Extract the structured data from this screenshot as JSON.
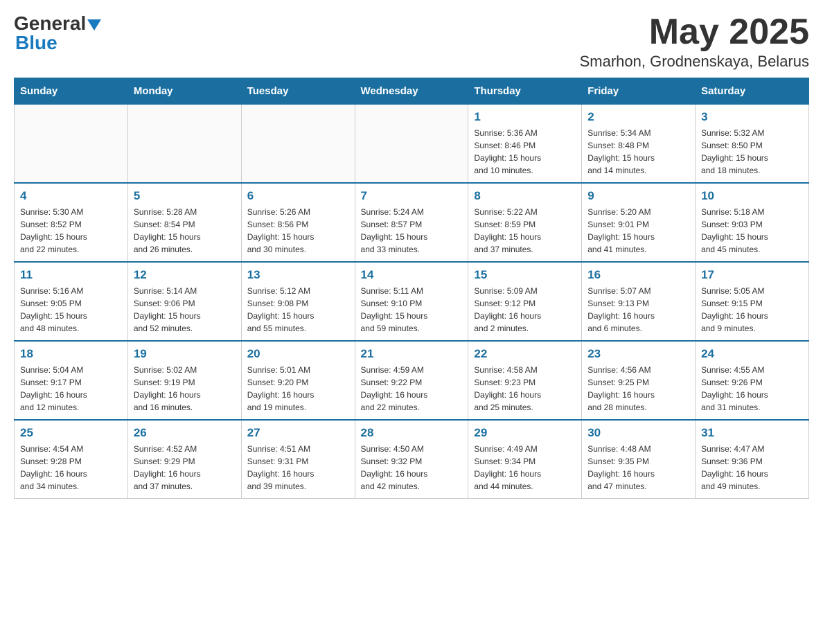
{
  "header": {
    "logo_general": "General",
    "logo_blue": "Blue",
    "month_year": "May 2025",
    "location": "Smarhon, Grodnenskaya, Belarus"
  },
  "weekdays": [
    "Sunday",
    "Monday",
    "Tuesday",
    "Wednesday",
    "Thursday",
    "Friday",
    "Saturday"
  ],
  "weeks": [
    [
      {
        "day": "",
        "info": ""
      },
      {
        "day": "",
        "info": ""
      },
      {
        "day": "",
        "info": ""
      },
      {
        "day": "",
        "info": ""
      },
      {
        "day": "1",
        "info": "Sunrise: 5:36 AM\nSunset: 8:46 PM\nDaylight: 15 hours\nand 10 minutes."
      },
      {
        "day": "2",
        "info": "Sunrise: 5:34 AM\nSunset: 8:48 PM\nDaylight: 15 hours\nand 14 minutes."
      },
      {
        "day": "3",
        "info": "Sunrise: 5:32 AM\nSunset: 8:50 PM\nDaylight: 15 hours\nand 18 minutes."
      }
    ],
    [
      {
        "day": "4",
        "info": "Sunrise: 5:30 AM\nSunset: 8:52 PM\nDaylight: 15 hours\nand 22 minutes."
      },
      {
        "day": "5",
        "info": "Sunrise: 5:28 AM\nSunset: 8:54 PM\nDaylight: 15 hours\nand 26 minutes."
      },
      {
        "day": "6",
        "info": "Sunrise: 5:26 AM\nSunset: 8:56 PM\nDaylight: 15 hours\nand 30 minutes."
      },
      {
        "day": "7",
        "info": "Sunrise: 5:24 AM\nSunset: 8:57 PM\nDaylight: 15 hours\nand 33 minutes."
      },
      {
        "day": "8",
        "info": "Sunrise: 5:22 AM\nSunset: 8:59 PM\nDaylight: 15 hours\nand 37 minutes."
      },
      {
        "day": "9",
        "info": "Sunrise: 5:20 AM\nSunset: 9:01 PM\nDaylight: 15 hours\nand 41 minutes."
      },
      {
        "day": "10",
        "info": "Sunrise: 5:18 AM\nSunset: 9:03 PM\nDaylight: 15 hours\nand 45 minutes."
      }
    ],
    [
      {
        "day": "11",
        "info": "Sunrise: 5:16 AM\nSunset: 9:05 PM\nDaylight: 15 hours\nand 48 minutes."
      },
      {
        "day": "12",
        "info": "Sunrise: 5:14 AM\nSunset: 9:06 PM\nDaylight: 15 hours\nand 52 minutes."
      },
      {
        "day": "13",
        "info": "Sunrise: 5:12 AM\nSunset: 9:08 PM\nDaylight: 15 hours\nand 55 minutes."
      },
      {
        "day": "14",
        "info": "Sunrise: 5:11 AM\nSunset: 9:10 PM\nDaylight: 15 hours\nand 59 minutes."
      },
      {
        "day": "15",
        "info": "Sunrise: 5:09 AM\nSunset: 9:12 PM\nDaylight: 16 hours\nand 2 minutes."
      },
      {
        "day": "16",
        "info": "Sunrise: 5:07 AM\nSunset: 9:13 PM\nDaylight: 16 hours\nand 6 minutes."
      },
      {
        "day": "17",
        "info": "Sunrise: 5:05 AM\nSunset: 9:15 PM\nDaylight: 16 hours\nand 9 minutes."
      }
    ],
    [
      {
        "day": "18",
        "info": "Sunrise: 5:04 AM\nSunset: 9:17 PM\nDaylight: 16 hours\nand 12 minutes."
      },
      {
        "day": "19",
        "info": "Sunrise: 5:02 AM\nSunset: 9:19 PM\nDaylight: 16 hours\nand 16 minutes."
      },
      {
        "day": "20",
        "info": "Sunrise: 5:01 AM\nSunset: 9:20 PM\nDaylight: 16 hours\nand 19 minutes."
      },
      {
        "day": "21",
        "info": "Sunrise: 4:59 AM\nSunset: 9:22 PM\nDaylight: 16 hours\nand 22 minutes."
      },
      {
        "day": "22",
        "info": "Sunrise: 4:58 AM\nSunset: 9:23 PM\nDaylight: 16 hours\nand 25 minutes."
      },
      {
        "day": "23",
        "info": "Sunrise: 4:56 AM\nSunset: 9:25 PM\nDaylight: 16 hours\nand 28 minutes."
      },
      {
        "day": "24",
        "info": "Sunrise: 4:55 AM\nSunset: 9:26 PM\nDaylight: 16 hours\nand 31 minutes."
      }
    ],
    [
      {
        "day": "25",
        "info": "Sunrise: 4:54 AM\nSunset: 9:28 PM\nDaylight: 16 hours\nand 34 minutes."
      },
      {
        "day": "26",
        "info": "Sunrise: 4:52 AM\nSunset: 9:29 PM\nDaylight: 16 hours\nand 37 minutes."
      },
      {
        "day": "27",
        "info": "Sunrise: 4:51 AM\nSunset: 9:31 PM\nDaylight: 16 hours\nand 39 minutes."
      },
      {
        "day": "28",
        "info": "Sunrise: 4:50 AM\nSunset: 9:32 PM\nDaylight: 16 hours\nand 42 minutes."
      },
      {
        "day": "29",
        "info": "Sunrise: 4:49 AM\nSunset: 9:34 PM\nDaylight: 16 hours\nand 44 minutes."
      },
      {
        "day": "30",
        "info": "Sunrise: 4:48 AM\nSunset: 9:35 PM\nDaylight: 16 hours\nand 47 minutes."
      },
      {
        "day": "31",
        "info": "Sunrise: 4:47 AM\nSunset: 9:36 PM\nDaylight: 16 hours\nand 49 minutes."
      }
    ]
  ]
}
